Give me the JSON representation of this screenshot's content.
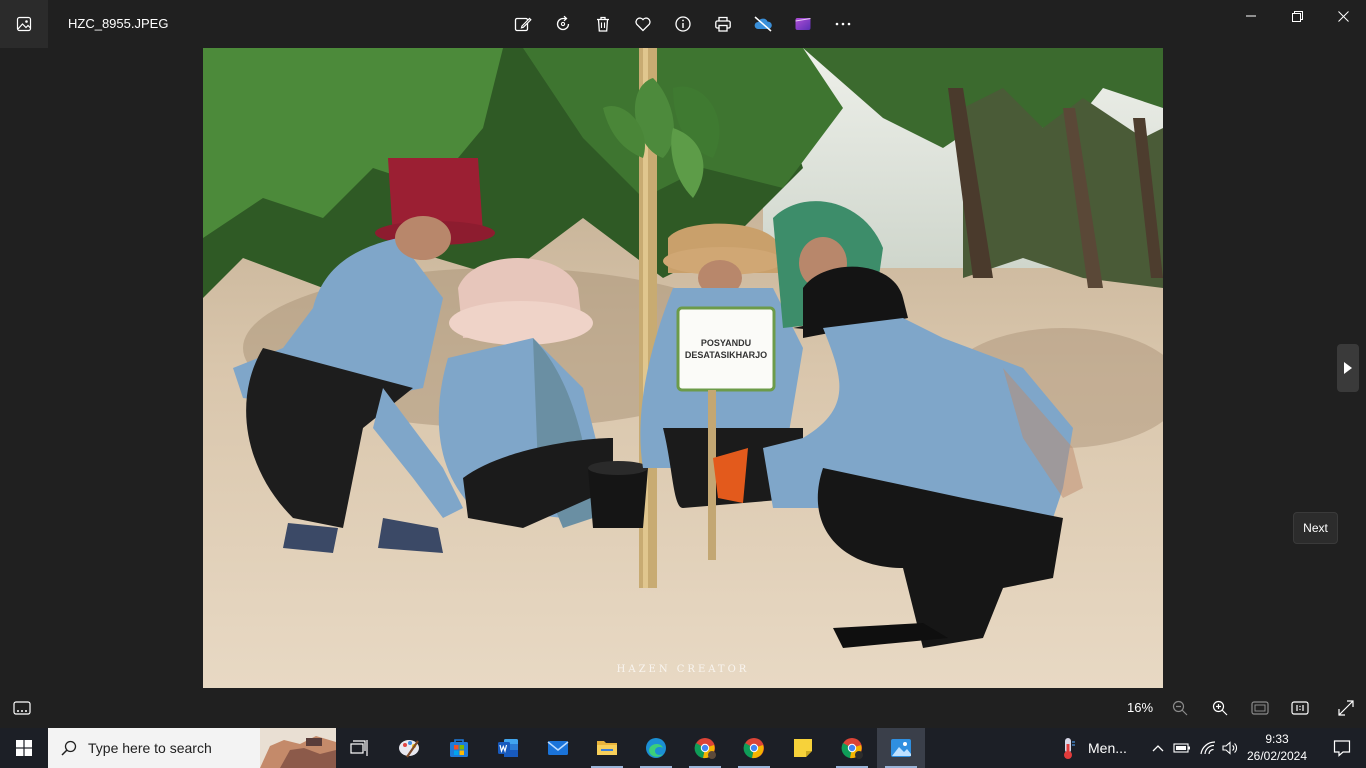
{
  "window": {
    "filename": "HZC_8955.JPEG"
  },
  "viewer": {
    "sign_line1": "POSYANDU",
    "sign_line2": "DESATASIKHARJO",
    "watermark": "HAZEN CREATOR",
    "next_tooltip": "Next"
  },
  "bottom": {
    "zoom": "16%"
  },
  "taskbar": {
    "search_placeholder": "Type here to search",
    "weather_label": "Men...",
    "time": "9:33",
    "date": "26/02/2024"
  },
  "colors": {
    "accent": "#0078d4",
    "background": "#202020"
  }
}
